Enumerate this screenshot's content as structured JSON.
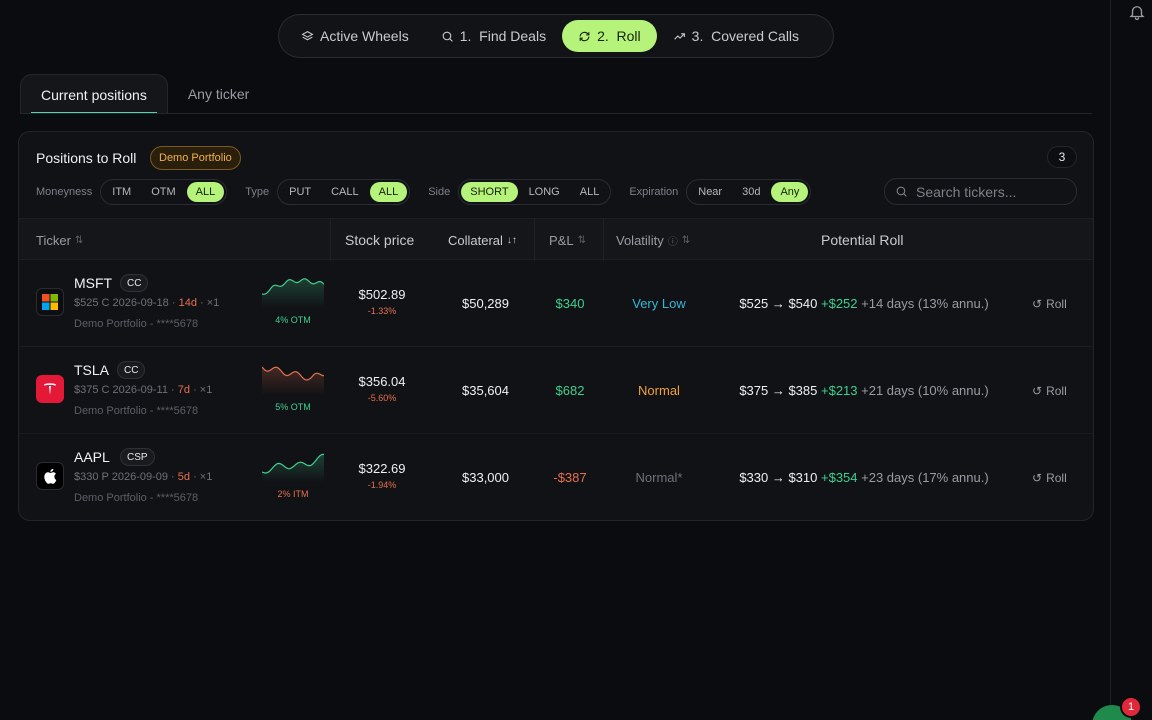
{
  "nav": {
    "items": [
      {
        "label": "Active Wheels",
        "icon": "layers-icon",
        "active": false
      },
      {
        "label": "1.  Find Deals",
        "icon": "search-icon",
        "active": false
      },
      {
        "label": "2.  Roll",
        "icon": "refresh-icon",
        "active": true
      },
      {
        "label": "3.  Covered Calls",
        "icon": "trending-up-icon",
        "active": false
      }
    ]
  },
  "tabs": [
    "Current positions",
    "Any ticker"
  ],
  "card": {
    "title": "Positions to Roll",
    "badge": "Demo Portfolio",
    "count": "3"
  },
  "filters": {
    "moneyness": {
      "label": "Moneyness",
      "options": [
        "ITM",
        "OTM",
        "ALL"
      ],
      "selected": "ALL"
    },
    "type": {
      "label": "Type",
      "options": [
        "PUT",
        "CALL",
        "ALL"
      ],
      "selected": "ALL"
    },
    "side": {
      "label": "Side",
      "options": [
        "SHORT",
        "LONG",
        "ALL"
      ],
      "selected": "SHORT"
    },
    "expiration": {
      "label": "Expiration",
      "options": [
        "Near",
        "30d",
        "Any"
      ],
      "selected": "Any"
    },
    "search_placeholder": "Search tickers..."
  },
  "columns": {
    "ticker": "Ticker",
    "stock_price": "Stock price",
    "collateral": "Collateral",
    "pnl": "P&L",
    "volatility": "Volatility",
    "potential_roll": "Potential Roll"
  },
  "rows": [
    {
      "symbol": "MSFT",
      "strategy": "CC",
      "option": "$525 C 2026-09-18 · ",
      "dte": "14d",
      "qty": " · ×1",
      "account": "Demo Portfolio - ****5678",
      "moneyness": "4% OTM",
      "moneyness_color": "#3fd08f",
      "spark_color": "#3fd08f",
      "price": "$502.89",
      "change": "-1.33%",
      "collateral": "$50,289",
      "pnl": "$340",
      "pnl_color": "#3fd08f",
      "volatility": "Very Low",
      "vol_color": "#38b6d6",
      "roll_strikes": "$525 → $540 ",
      "roll_premium": "+$252",
      "roll_days": " +14 days (13% annu.)",
      "roll_button": "Roll"
    },
    {
      "symbol": "TSLA",
      "strategy": "CC",
      "option": "$375 C 2026-09-11 · ",
      "dte": "7d",
      "qty": " · ×1",
      "account": "Demo Portfolio - ****5678",
      "moneyness": "5% OTM",
      "moneyness_color": "#3fd08f",
      "spark_color": "#e5704e",
      "price": "$356.04",
      "change": "-5.60%",
      "collateral": "$35,604",
      "pnl": "$682",
      "pnl_color": "#3fd08f",
      "volatility": "Normal",
      "vol_color": "#f0a03a",
      "roll_strikes": "$375 → $385 ",
      "roll_premium": "+$213",
      "roll_days": " +21 days (10% annu.)",
      "roll_button": "Roll"
    },
    {
      "symbol": "AAPL",
      "strategy": "CSP",
      "option": "$330 P 2026-09-09 · ",
      "dte": "5d",
      "qty": " · ×1",
      "account": "Demo Portfolio - ****5678",
      "moneyness": "2% ITM",
      "moneyness_color": "#e5704e",
      "spark_color": "#3fd08f",
      "price": "$322.69",
      "change": "-1.94%",
      "collateral": "$33,000",
      "pnl": "-$387",
      "pnl_color": "#e5704e",
      "volatility": "Normal*",
      "vol_color": "#6e7178",
      "roll_strikes": "$330 → $310 ",
      "roll_premium": "+$354",
      "roll_days": " +23 days (17% annu.)",
      "roll_button": "Roll"
    }
  ],
  "notifications": {
    "count": "1"
  }
}
